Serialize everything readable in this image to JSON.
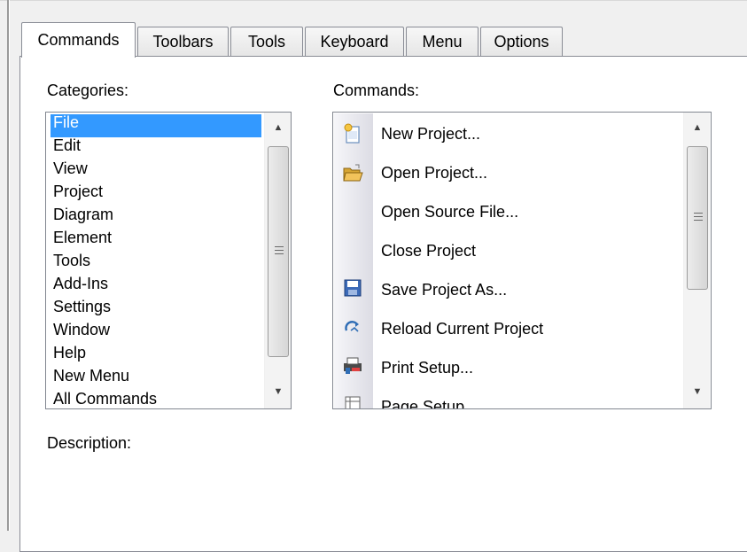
{
  "tabs": [
    {
      "label": "Commands",
      "active": true
    },
    {
      "label": "Toolbars",
      "active": false
    },
    {
      "label": "Tools",
      "active": false
    },
    {
      "label": "Keyboard",
      "active": false
    },
    {
      "label": "Menu",
      "active": false
    },
    {
      "label": "Options",
      "active": false
    }
  ],
  "categories": {
    "label": "Categories:",
    "selected": "File",
    "items": [
      "File",
      "Edit",
      "View",
      "Project",
      "Diagram",
      "Element",
      "Tools",
      "Add-Ins",
      "Settings",
      "Window",
      "Help",
      "New Menu",
      "All Commands"
    ]
  },
  "commands": {
    "label": "Commands:",
    "items": [
      {
        "label": "New Project...",
        "icon": "new-project-icon"
      },
      {
        "label": "Open Project...",
        "icon": "open-folder-icon"
      },
      {
        "label": "Open Source File...",
        "icon": ""
      },
      {
        "label": "Close Project",
        "icon": ""
      },
      {
        "label": "Save Project As...",
        "icon": "save-disk-icon"
      },
      {
        "label": "Reload Current Project",
        "icon": "reload-icon"
      },
      {
        "label": "Print Setup...",
        "icon": "print-setup-icon"
      },
      {
        "label": "Page Setup",
        "icon": "page-setup-icon"
      }
    ]
  },
  "description": {
    "label": "Description:"
  },
  "colors": {
    "selection": "#3399ff",
    "panel": "#ffffff",
    "dialog": "#f0f0f0"
  }
}
